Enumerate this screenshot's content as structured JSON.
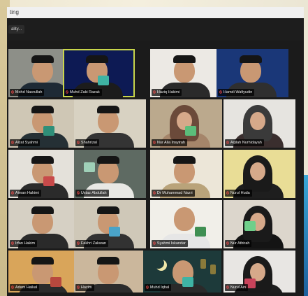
{
  "window": {
    "title_partial": "ting",
    "view_chip": "ality..."
  },
  "tiles": [
    {
      "id": "r1c1",
      "name": "Mohd Nasrullah"
    },
    {
      "id": "r1c2",
      "name": "Muhd Zaki Razak"
    },
    {
      "id": "r1c3",
      "name": "Haziq Hakimi"
    },
    {
      "id": "r1c4",
      "name": "Hamdi Wafiyudin"
    },
    {
      "id": "r2c1",
      "name": "Aizat Syahmi"
    },
    {
      "id": "r2c2",
      "name": "Shahrizal"
    },
    {
      "id": "r2c3",
      "name": "Nur Alia Insyirah"
    },
    {
      "id": "r2c4",
      "name": "Aqilah Nurhidayah"
    },
    {
      "id": "r3c1",
      "name": "Aiman Hakimi"
    },
    {
      "id": "r3c2",
      "name": "Ustaz Abdullah"
    },
    {
      "id": "r3c3",
      "name": "Dr Muhammad Nazri"
    },
    {
      "id": "r3c4",
      "name": "Nurul Huda"
    },
    {
      "id": "r4c1",
      "name": "Irfan Hakim"
    },
    {
      "id": "r4c2",
      "name": "Fakhri Zakwan"
    },
    {
      "id": "r4c3",
      "name": "Syahmi Iskandar"
    },
    {
      "id": "r4c4",
      "name": "Nur Athirah"
    },
    {
      "id": "r5c1",
      "name": "Adam Haikal"
    },
    {
      "id": "r5c2",
      "name": "Hazim"
    },
    {
      "id": "r5c3",
      "name": "Muhd Iqbal"
    },
    {
      "id": "r5c4",
      "name": "Nurul Ain"
    }
  ]
}
